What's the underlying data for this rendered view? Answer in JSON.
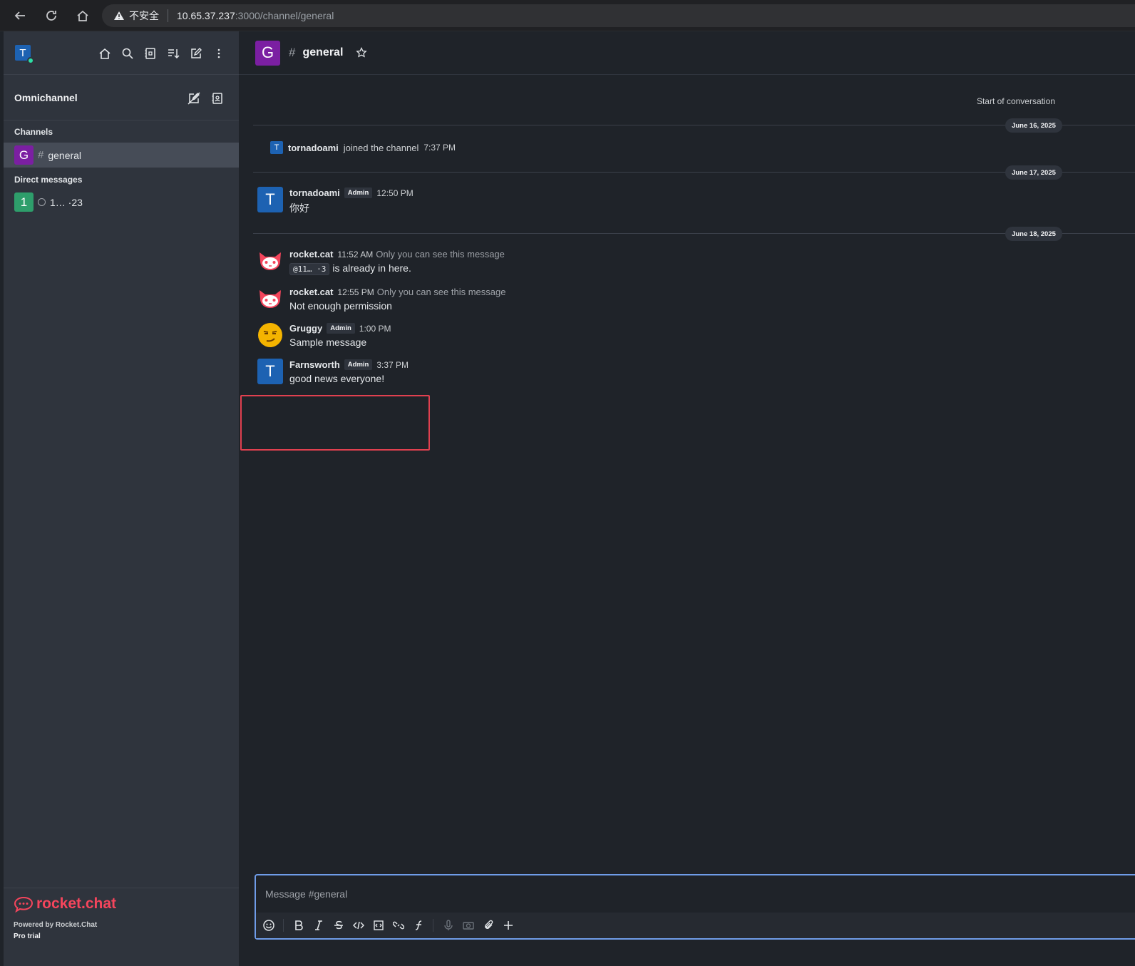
{
  "browser": {
    "warning": "不安全",
    "url_host": "10.65.37.237",
    "url_path": ":3000/channel/general"
  },
  "sidebar": {
    "user_initial": "T",
    "omnichannel": "Omnichannel",
    "channels_label": "Channels",
    "channels": [
      {
        "initial": "G",
        "name": "general",
        "color": "#7b1fa2"
      }
    ],
    "dm_label": "Direct messages",
    "dms": [
      {
        "initial": "1",
        "name": "1… ·23",
        "color": "#2e9e6b"
      }
    ],
    "footer": {
      "logo": "rocket.chat",
      "powered": "Powered by Rocket.Chat",
      "plan": "Pro trial"
    }
  },
  "room": {
    "initial": "G",
    "name": "general"
  },
  "messages": {
    "start": "Start of conversation",
    "dates": [
      "June 16, 2025",
      "June 17, 2025",
      "June 18, 2025"
    ],
    "system": {
      "initial": "T",
      "user": "tornadoami",
      "text": "joined the channel",
      "time": "7:37 PM"
    },
    "list": [
      {
        "initial": "T",
        "user": "tornadoami",
        "badge": "Admin",
        "time": "12:50 PM",
        "text": "你好"
      },
      {
        "user": "rocket.cat",
        "time": "11:52 AM",
        "note": "Only you can see this message",
        "mention": "@11… ·3",
        "text": "is already in here."
      },
      {
        "user": "rocket.cat",
        "time": "12:55 PM",
        "note": "Only you can see this message",
        "text": "Not enough permission"
      },
      {
        "user": "Gruggy",
        "badge": "Admin",
        "time": "1:00 PM",
        "text": "Sample message"
      },
      {
        "initial": "T",
        "user": "Farnsworth",
        "badge": "Admin",
        "time": "3:37 PM",
        "text": "good news everyone!"
      }
    ]
  },
  "composer": {
    "placeholder": "Message #general"
  },
  "colors": {
    "accent": "#1d62b2",
    "highlight": "#e0404f",
    "brand": "#f5455c"
  }
}
